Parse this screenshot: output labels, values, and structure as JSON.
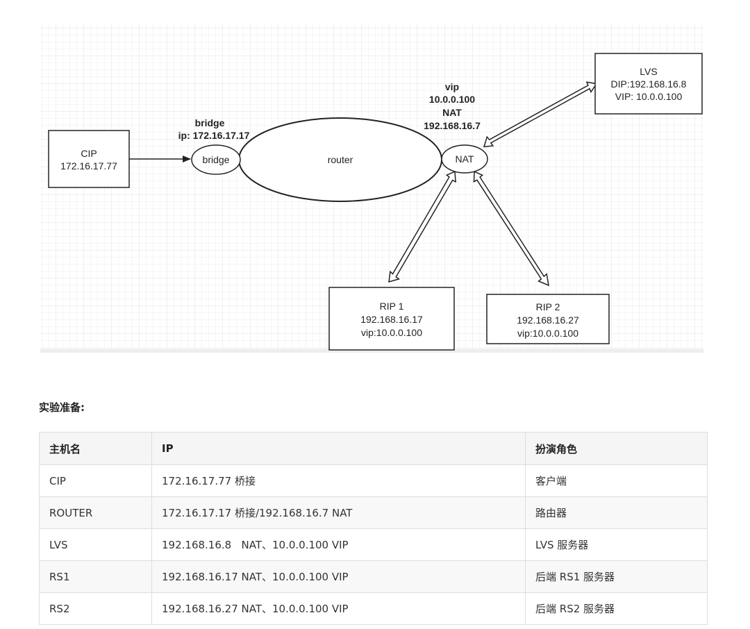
{
  "diagram": {
    "nodes": {
      "cip": {
        "lines": [
          "CIP",
          "172.16.17.77"
        ]
      },
      "bridge": {
        "label": "bridge"
      },
      "router": {
        "label": "router"
      },
      "nat": {
        "label": "NAT"
      },
      "lvs": {
        "lines": [
          "LVS",
          "DIP:192.168.16.8",
          "VIP: 10.0.0.100"
        ]
      },
      "rip1": {
        "lines": [
          "RIP 1",
          "192.168.16.17",
          "vip:10.0.0.100"
        ]
      },
      "rip2": {
        "lines": [
          "RIP 2",
          "192.168.16.27",
          "vip:10.0.0.100"
        ]
      }
    },
    "labels": {
      "bridge_title": "bridge",
      "bridge_ip": "ip:  172.16.17.17",
      "nat_vip_title": "vip",
      "nat_vip": "10.0.0.100",
      "nat_title": "NAT",
      "nat_ip": "192.168.16.7"
    },
    "edges": [
      {
        "from": "cip",
        "to": "bridge",
        "style": "single-arrow"
      },
      {
        "from": "nat",
        "to": "lvs",
        "style": "double-hollow-arrow"
      },
      {
        "from": "nat",
        "to": "rip1",
        "style": "double-hollow-arrow"
      },
      {
        "from": "nat",
        "to": "rip2",
        "style": "double-hollow-arrow"
      }
    ]
  },
  "section": {
    "heading": "实验准备:"
  },
  "table": {
    "headers": [
      "主机名",
      "IP",
      "扮演角色"
    ],
    "rows": [
      [
        "CIP",
        "172.16.17.77 桥接",
        "客户端"
      ],
      [
        "ROUTER",
        "172.16.17.17 桥接/192.168.16.7 NAT",
        "路由器"
      ],
      [
        "LVS",
        "192.168.16.8   NAT、10.0.0.100 VIP",
        "LVS 服务器"
      ],
      [
        "RS1",
        "192.168.16.17 NAT、10.0.0.100 VIP",
        "后端 RS1 服务器"
      ],
      [
        "RS2",
        "192.168.16.27 NAT、10.0.0.100 VIP",
        "后端 RS2 服务器"
      ]
    ]
  }
}
